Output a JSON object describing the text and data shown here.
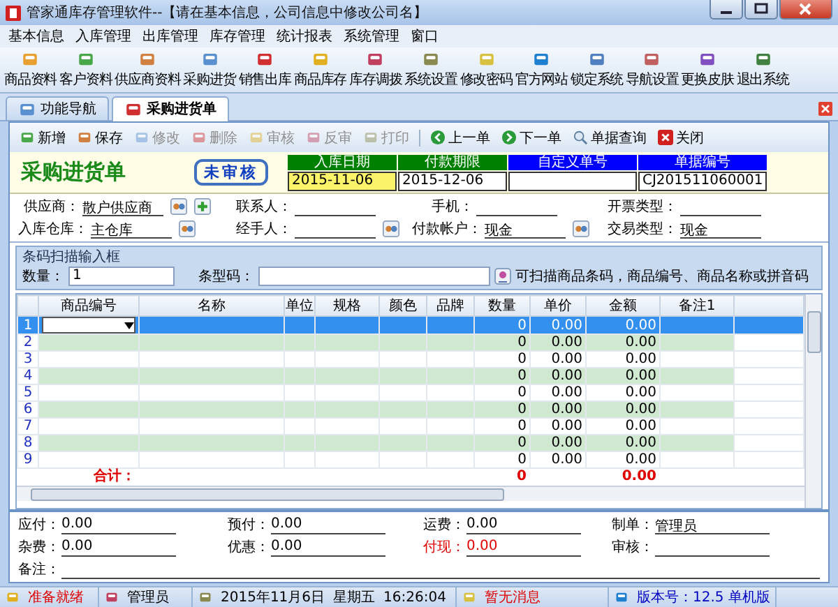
{
  "window": {
    "title": "管家通库存管理软件--【请在基本信息，公司信息中修改公司名】"
  },
  "menu": [
    "基本信息",
    "入库管理",
    "出库管理",
    "库存管理",
    "统计报表",
    "系统管理",
    "窗口"
  ],
  "toolbar": [
    "商品资料",
    "客户资料",
    "供应商资料",
    "采购进货",
    "销售出库",
    "商品库存",
    "库存调拨",
    "系统设置",
    "修改密码",
    "官方网站",
    "锁定系统",
    "导航设置",
    "更换皮肤",
    "退出系统"
  ],
  "tabs": [
    {
      "label": "功能导航",
      "selected": false
    },
    {
      "label": "采购进货单",
      "selected": true
    }
  ],
  "actions": [
    {
      "label": "新增",
      "disabled": false
    },
    {
      "label": "保存",
      "disabled": false
    },
    {
      "label": "修改",
      "disabled": true
    },
    {
      "label": "删除",
      "disabled": true
    },
    {
      "label": "审核",
      "disabled": true
    },
    {
      "label": "反审",
      "disabled": true
    },
    {
      "label": "打印",
      "disabled": true
    }
  ],
  "nav_actions": [
    {
      "label": "上一单",
      "kind": "prev"
    },
    {
      "label": "下一单",
      "kind": "next"
    },
    {
      "label": "单据查询",
      "kind": "query"
    },
    {
      "label": "关闭",
      "kind": "close"
    }
  ],
  "document": {
    "title": "采购进货单",
    "status": "未审核",
    "header_fields": [
      {
        "label": "入库日期",
        "value": "2015-11-06",
        "color": "#008000",
        "highlighted": true
      },
      {
        "label": "付款期限",
        "value": "2015-12-06",
        "color": "#008000",
        "highlighted": false
      },
      {
        "label": "自定义单号",
        "color": "#0000ff",
        "highlighted": false
      },
      {
        "label": "单据编号",
        "value": "CJ201511060001",
        "color": "#0000ff",
        "highlighted": false
      }
    ]
  },
  "form": {
    "rows": [
      [
        {
          "label": "供应商：",
          "value": "散户供应商",
          "kind": "lookup_add"
        },
        {
          "label": "联系人：",
          "kind": "plain"
        },
        {
          "label": "手机：",
          "kind": "plain"
        },
        {
          "label": "开票类型：",
          "kind": "plain"
        }
      ],
      [
        {
          "label": "入库仓库：",
          "value": "主仓库",
          "kind": "lookup"
        },
        {
          "label": "经手人：",
          "kind": "lookup"
        },
        {
          "label": "付款帐户：",
          "value": "现金",
          "kind": "lookup"
        },
        {
          "label": "交易类型：",
          "value": "现金",
          "kind": "plain"
        }
      ]
    ]
  },
  "barcode": {
    "title": "条码扫描输入框",
    "quantity_label": "数量：",
    "quantity": "1",
    "barcode_label": "条型码：",
    "hint": "可扫描商品条码，商品编号、商品名称或拼音码"
  },
  "table": {
    "columns": [
      "商品编号",
      "名称",
      "单位",
      "规格",
      "颜色",
      "品牌",
      "数量",
      "单价",
      "金额",
      "备注1"
    ],
    "rows": [
      {
        "no": "1",
        "quantity": "0",
        "price": "0.00",
        "amount": "0.00",
        "selected": true,
        "editing": true
      },
      {
        "no": "2",
        "quantity": "0",
        "price": "0.00",
        "amount": "0.00",
        "selected": false,
        "editing": false
      },
      {
        "no": "3",
        "quantity": "0",
        "price": "0.00",
        "amount": "0.00",
        "selected": false,
        "editing": false
      },
      {
        "no": "4",
        "quantity": "0",
        "price": "0.00",
        "amount": "0.00",
        "selected": false,
        "editing": false
      },
      {
        "no": "5",
        "quantity": "0",
        "price": "0.00",
        "amount": "0.00",
        "selected": false,
        "editing": false
      },
      {
        "no": "6",
        "quantity": "0",
        "price": "0.00",
        "amount": "0.00",
        "selected": false,
        "editing": false
      },
      {
        "no": "7",
        "quantity": "0",
        "price": "0.00",
        "amount": "0.00",
        "selected": false,
        "editing": false
      },
      {
        "no": "8",
        "quantity": "0",
        "price": "0.00",
        "amount": "0.00",
        "selected": false,
        "editing": false
      },
      {
        "no": "9",
        "quantity": "0",
        "price": "0.00",
        "amount": "0.00",
        "selected": false,
        "editing": false
      }
    ],
    "totals": {
      "label": "合计：",
      "quantity": "0",
      "amount": "0.00"
    }
  },
  "footer": {
    "rows": [
      [
        {
          "label": "应付：",
          "value": "0.00",
          "highlighted": false
        },
        {
          "label": "预付：",
          "value": "0.00",
          "highlighted": false
        },
        {
          "label": "运费：",
          "value": "0.00",
          "highlighted": false
        },
        {
          "label": "制单：",
          "value": "管理员",
          "highlighted": false
        }
      ],
      [
        {
          "label": "杂费：",
          "value": "0.00",
          "highlighted": false
        },
        {
          "label": "优惠：",
          "value": "0.00",
          "highlighted": false
        },
        {
          "label": "付现：",
          "value": "0.00",
          "highlighted": true
        },
        {
          "label": "审核：",
          "highlighted": false
        }
      ]
    ],
    "notes_label": "备注："
  },
  "status_bar": [
    {
      "parts": [
        "准备就绪"
      ],
      "color": "#e00000"
    },
    {
      "parts": [
        "管理员"
      ],
      "color": "#000000"
    },
    {
      "parts": [
        "2015年11月6日",
        "星期五",
        "16:26:04"
      ],
      "color": "#000000"
    },
    {
      "parts": [
        "暂无消息"
      ],
      "color": "#e00000"
    },
    {
      "parts": [
        "版本号：12.5 单机版"
      ],
      "color": "#0000c0"
    }
  ]
}
